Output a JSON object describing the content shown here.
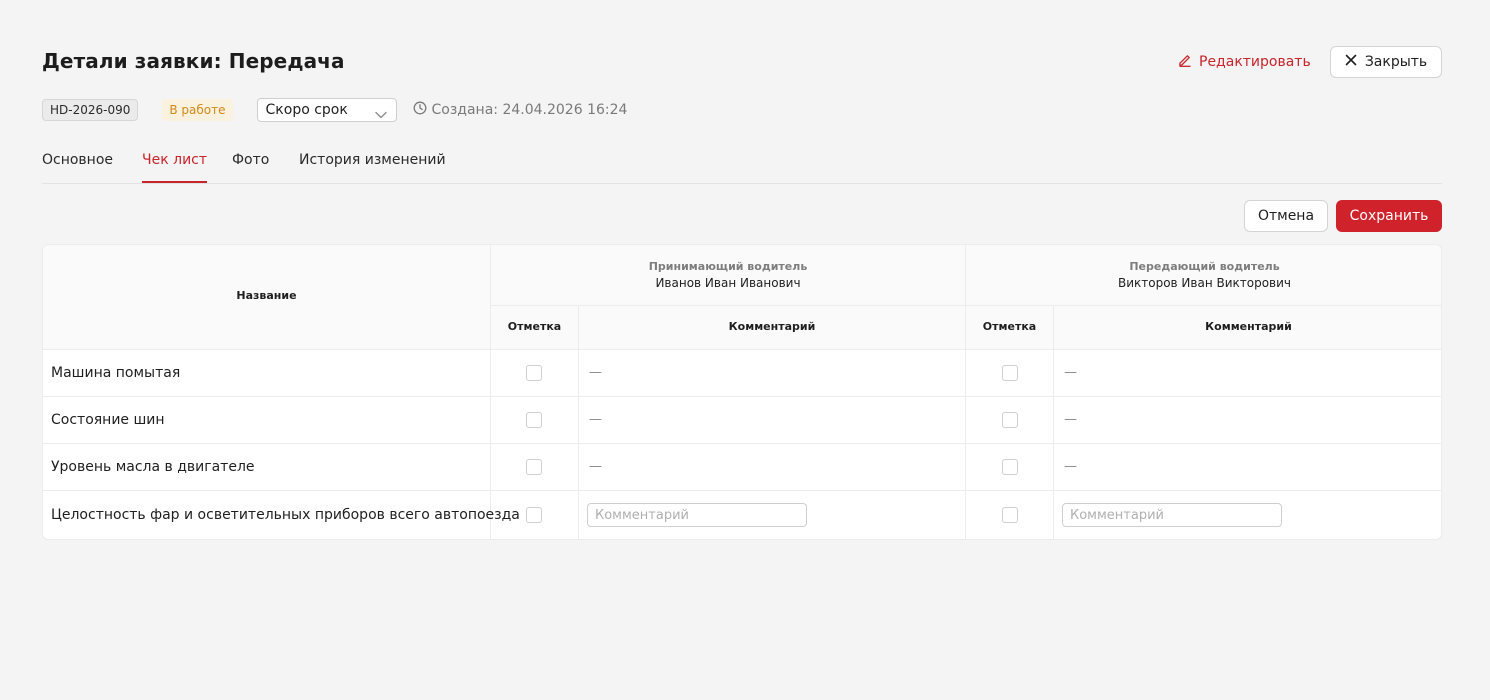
{
  "header": {
    "title": "Детали заявки: Передача",
    "edit_label": "Редактировать",
    "close_label": "Закрыть"
  },
  "meta": {
    "id": "HD-2026-090",
    "status": "В работе",
    "priority": "Скоро срок",
    "created": "Создана: 24.04.2026 16:24"
  },
  "tabs": [
    {
      "label": "Основное"
    },
    {
      "label": "Чек лист",
      "active": true
    },
    {
      "label": "Фото"
    },
    {
      "label": "История изменений"
    }
  ],
  "actions": {
    "cancel_label": "Отмена",
    "save_label": "Сохранить"
  },
  "table": {
    "name_header": "Название",
    "receiving": {
      "role": "Принимающий водитель",
      "name": "Иванов Иван Иванович"
    },
    "handing": {
      "role": "Передающий водитель",
      "name": "Викторов Иван Викторович"
    },
    "mark_header": "Отметка",
    "comment_header": "Комментарий",
    "empty_value": "—",
    "comment_placeholder": "Комментарий",
    "rows": [
      {
        "name": "Машина помытая"
      },
      {
        "name": "Состояние шин"
      },
      {
        "name": "Уровень масла в двигателе"
      },
      {
        "name": "Целостность фар и осветительных приборов всего автопоезда"
      }
    ]
  },
  "colors": {
    "accent": "#c8242b",
    "save_button": "#d0222a",
    "status_text": "#d08a1a",
    "status_bg": "#fbf1df"
  }
}
